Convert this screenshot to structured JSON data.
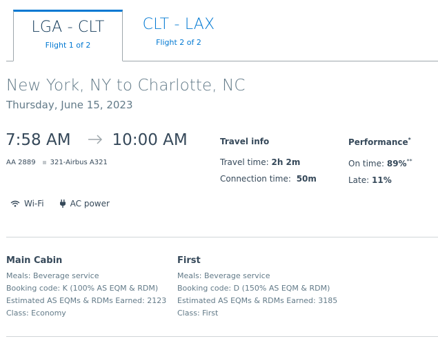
{
  "tabs": [
    {
      "route": "LGA - CLT",
      "sub": "Flight 1 of 2"
    },
    {
      "route": "CLT - LAX",
      "sub": "Flight 2 of 2"
    }
  ],
  "heading": "New York, NY to Charlotte, NC",
  "date": "Thursday, June 15, 2023",
  "depart_time": "7:58 AM",
  "arrive_time": "10:00 AM",
  "flight_number": "AA 2889",
  "aircraft": "321-Airbus A321",
  "travel_info": {
    "title": "Travel info",
    "travel_time_label": "Travel time:",
    "travel_time_value": "2h 2m",
    "connection_label": "Connection time:",
    "connection_value": "50m"
  },
  "performance": {
    "title": "Performance",
    "title_mark": "*",
    "on_time_label": "On time:",
    "on_time_value": "89%",
    "on_time_mark": "**",
    "late_label": "Late:",
    "late_value": "11%"
  },
  "amenities": {
    "wifi": "Wi-Fi",
    "ac_power": "AC power"
  },
  "cabins": [
    {
      "title": "Main Cabin",
      "meals": "Meals: Beverage service",
      "booking": "Booking code: K (100% AS EQM & RDM)",
      "estimated": "Estimated AS EQMs & RDMs Earned: 2123",
      "class": "Class: Economy"
    },
    {
      "title": "First",
      "meals": "Meals: Beverage service",
      "booking": "Booking code: D (150% AS EQM & RDM)",
      "estimated": "Estimated AS EQMs & RDMs Earned: 3185",
      "class": "Class: First"
    }
  ]
}
